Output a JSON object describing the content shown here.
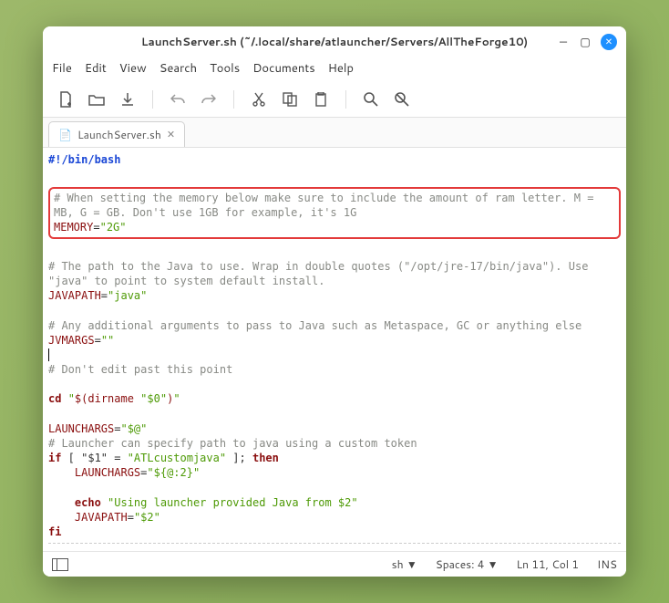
{
  "titlebar": {
    "title": "LaunchServer.sh (~/.local/share/atlauncher/Servers/AllTheForge10)"
  },
  "menubar": [
    "File",
    "Edit",
    "View",
    "Search",
    "Tools",
    "Documents",
    "Help"
  ],
  "tab": {
    "label": "LaunchServer.sh"
  },
  "code": {
    "shebang": "#!/bin/bash",
    "c1a": "# When setting the memory below make sure to include the amount of ram letter. M =",
    "c1b": "MB, G = GB. Don't use 1GB for example, it's 1G",
    "memLbl": "MEMORY",
    "memVal": "\"2G\"",
    "c2a": "# The path to the Java to use. Wrap in double quotes (\"/opt/jre-17/bin/java\"). Use",
    "c2b": "\"java\" to point to system default install.",
    "jpLbl": "JAVAPATH",
    "jpVal": "\"java\"",
    "c3": "# Any additional arguments to pass to Java such as Metaspace, GC or anything else",
    "jvmLbl": "JVMARGS",
    "jvmVal": "\"\"",
    "c4": "# Don't edit past this point",
    "cdLbl": "cd ",
    "cdVal": "\"$(dirname \"$0\")\"",
    "laLbl": "LAUNCHARGS",
    "laVal": "\"$@\"",
    "c5": "# Launcher can specify path to java using a custom token",
    "ifLine_kw1": "if",
    "ifLine_arg1": " [ \"$1\" ",
    "ifLine_eq": "= ",
    "ifLine_arg2": "\"ATLcustomjava\"",
    "ifLine_end": " ]; ",
    "ifLine_kw2": "then",
    "laLbl2": "    LAUNCHARGS",
    "laVal2": "\"${@:2}\"",
    "echoLbl": "    echo ",
    "echoVal": "\"Using launcher provided Java from $2\"",
    "jpLbl2": "    JAVAPATH",
    "jpVal2": "\"$2\"",
    "fi": "fi"
  },
  "statusbar": {
    "lang": "sh",
    "spaces": "Spaces: 4",
    "pos": "Ln 11, Col 1",
    "mode": "INS"
  }
}
